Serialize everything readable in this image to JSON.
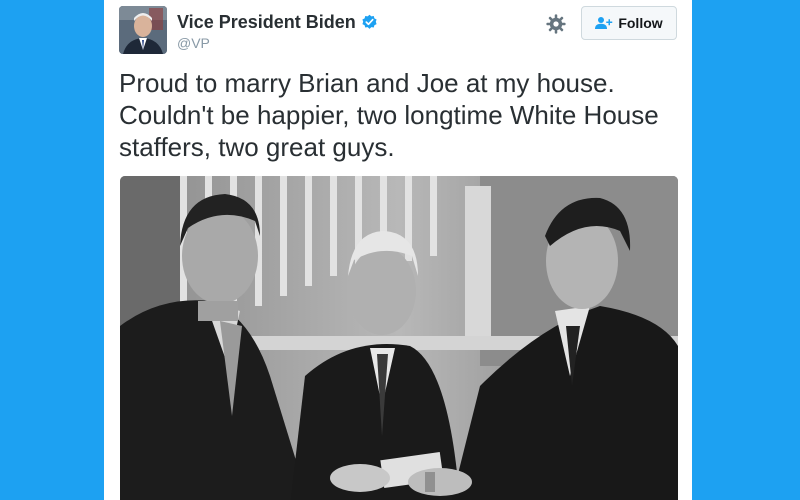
{
  "tweet": {
    "display_name": "Vice President Biden",
    "handle": "@VP",
    "verified": true,
    "text": "Proud to marry Brian and Joe at my house. Couldn't be happier, two longtime White House staffers, two great guys.",
    "icons": {
      "verified": "verified-badge-icon",
      "settings": "gear-icon",
      "follow": "add-user-icon"
    }
  },
  "actions": {
    "follow_label": "Follow"
  },
  "colors": {
    "background": "#1da1f2",
    "verified": "#1da1f2",
    "follow_icon": "#1da1f2",
    "text": "#292f33",
    "handle": "#8899a6"
  }
}
